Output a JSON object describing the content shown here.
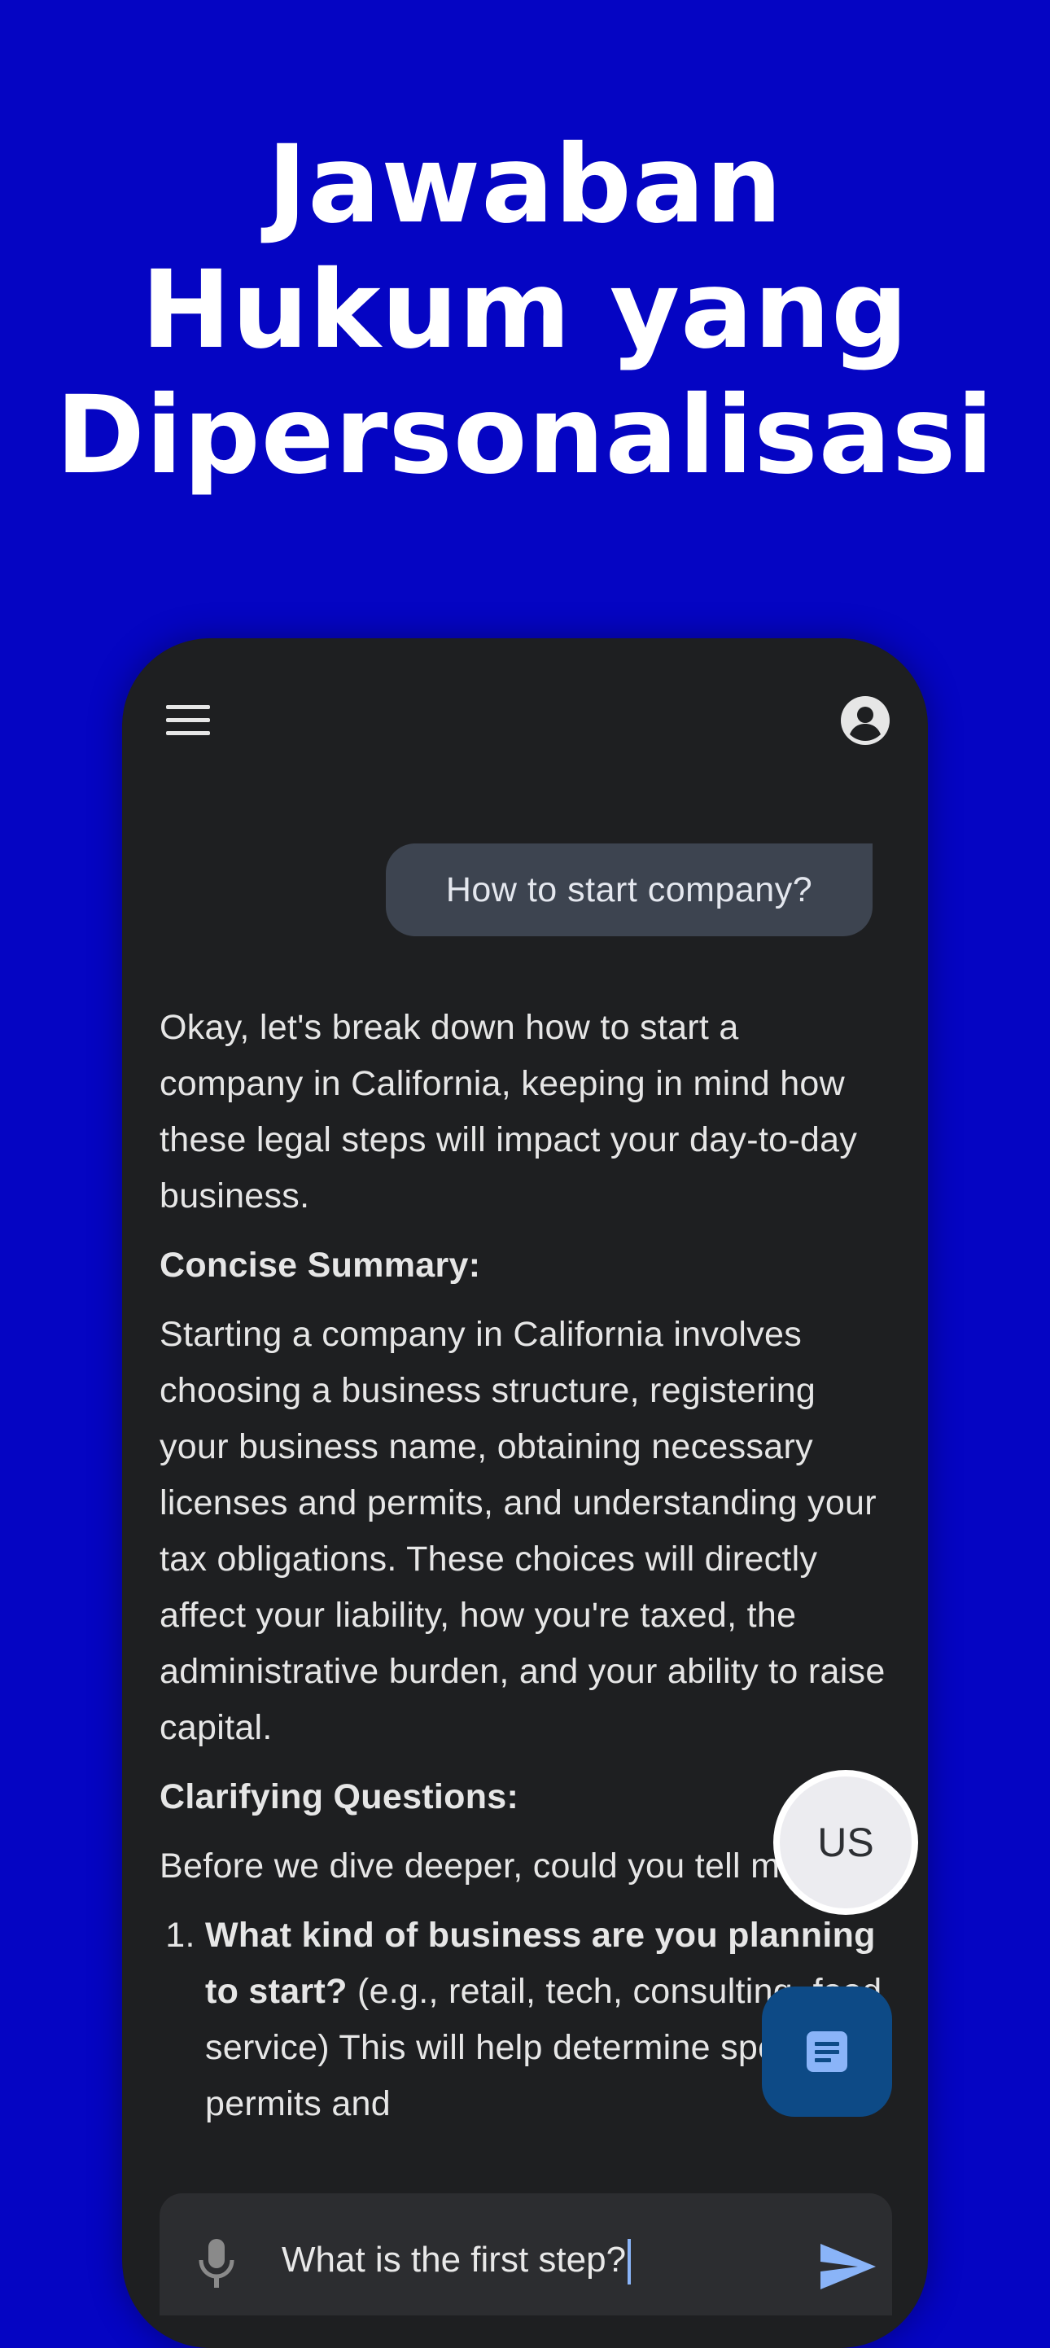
{
  "headline": {
    "line1": "Jawaban",
    "line2": "Hukum yang",
    "line3": "Dipersonalisasi"
  },
  "topbar": {
    "menu_icon": "hamburger-menu-icon",
    "account_icon": "account-circle-icon"
  },
  "chat": {
    "user_message": "How to start company?",
    "response": {
      "intro": "Okay, let's break down how to start a company in California, keeping in mind how these legal steps will impact your day-to-day business.",
      "summary_heading": "Concise Summary:",
      "summary_text": "Starting a company in California involves choosing a business structure, registering your business name, obtaining necessary licenses and permits, and understanding your tax obligations. These choices will directly affect your liability, how you're taxed, the administrative burden, and your ability to raise capital.",
      "questions_heading": "Clarifying Questions:",
      "questions_intro": "Before we dive deeper, could you tell me:",
      "question_1_bold": "What kind of business are you planning to start?",
      "question_1_text": " (e.g., retail, tech, consulting, food service) This will help determine specific permits and"
    }
  },
  "fab": {
    "region_label": "US",
    "document_icon": "document-icon"
  },
  "input": {
    "value": "What is the first step?",
    "mic_icon": "microphone-icon",
    "send_icon": "send-icon"
  },
  "colors": {
    "background": "#0505c3",
    "phone": "#1e1f21",
    "user_bubble": "#3d4450",
    "doc_fab": "#0d4a86",
    "send": "#8ab4f8"
  }
}
